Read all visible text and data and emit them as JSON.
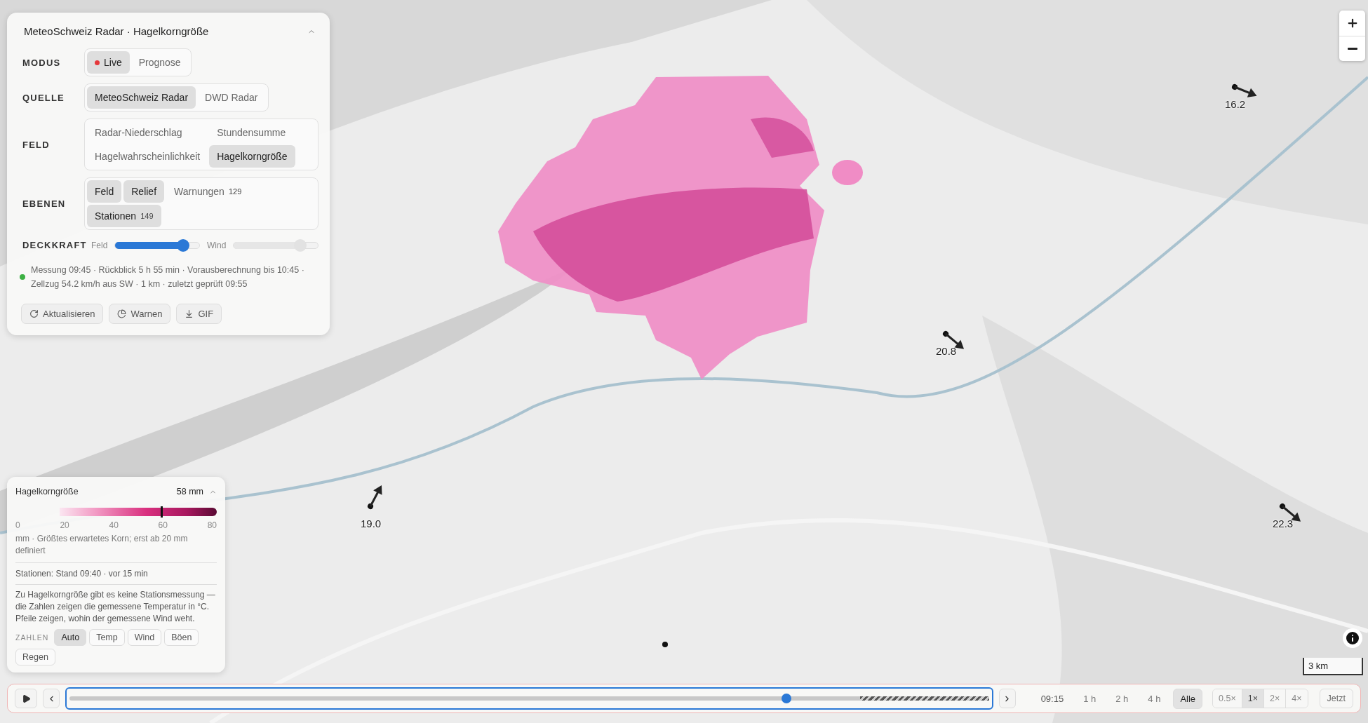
{
  "panel": {
    "title": "MeteoSchweiz Radar · Hagelkorngröße",
    "collapsed": false,
    "rows": [
      {
        "label": "MODUS",
        "options": [
          {
            "label": "Live",
            "selected": true,
            "indicator": true
          },
          {
            "label": "Prognose",
            "selected": false,
            "indicator": false
          }
        ]
      },
      {
        "label": "QUELLE",
        "options": [
          {
            "label": "MeteoSchweiz Radar",
            "selected": true,
            "indicator": false
          },
          {
            "label": "DWD Radar",
            "selected": false,
            "indicator": false
          }
        ]
      },
      {
        "label": "FELD",
        "options": [
          {
            "label": "Radar-Niederschlag",
            "selected": false,
            "indicator": false
          },
          {
            "label": "Stundensumme",
            "selected": false,
            "indicator": false
          },
          {
            "label": "Hagelwahrscheinlichkeit",
            "selected": false,
            "indicator": false
          },
          {
            "label": "Hagelkorngröße",
            "selected": true,
            "indicator": false
          }
        ]
      },
      {
        "label": "EBENEN",
        "options": [
          {
            "label": "Feld",
            "selected": true,
            "indicator": false
          },
          {
            "label": "Relief",
            "selected": true,
            "indicator": false
          },
          {
            "label": "Warnungen",
            "count": "129",
            "selected": false,
            "indicator": false
          },
          {
            "label": "Stationen",
            "count": "149",
            "selected": true,
            "indicator": false
          }
        ]
      }
    ],
    "opacity": {
      "label": "DECKKRAFT",
      "sliders": [
        {
          "label": "Feld",
          "level": 0.81,
          "disabled": false
        },
        {
          "label": "Wind",
          "level": 0.79,
          "disabled": true
        }
      ]
    },
    "status": {
      "ok": true,
      "text": "Messung 09:45 · Rückblick 5 h 55 min · Vorausberechnung bis 10:45 · Zellzug 54.2 km/h aus SW · 1 km · zuletzt geprüft 09:55"
    },
    "actions": [
      {
        "label": "Aktualisieren"
      },
      {
        "label": "Warnen"
      },
      {
        "label": "GIF"
      }
    ]
  },
  "legend": {
    "title": "Hagelkorngröße",
    "value": "58 mm",
    "collapsed": false,
    "scale": {
      "level": 0.725,
      "ticks": [
        "0",
        "20",
        "40",
        "60",
        "80"
      ]
    },
    "unit_note": "mm · Größtes erwartetes Korn; erst ab 20 mm definiert",
    "stations_note": "Stationen: Stand 09:40 · vor 15 min",
    "info": "Zu Hagelkorngröße gibt es keine Stationsmessung — die Zahlen zeigen die gemessene Temperatur in °C. Pfeile zeigen, wohin der gemessene Wind weht.",
    "numbers": {
      "label": "ZAHLEN",
      "options": [
        {
          "label": "Auto",
          "selected": true
        },
        {
          "label": "Temp",
          "selected": false
        },
        {
          "label": "Wind",
          "selected": false
        },
        {
          "label": "Böen",
          "selected": false
        },
        {
          "label": "Regen",
          "selected": false
        }
      ]
    }
  },
  "map": {
    "kind": "picture",
    "stations": [
      {
        "kind": "arrow",
        "value": "16.2"
      },
      {
        "kind": "arrow",
        "value": "20.8"
      },
      {
        "kind": "arrow",
        "value": "19.0"
      },
      {
        "kind": "arrow",
        "value": "22.3"
      },
      {
        "kind": "dot"
      }
    ],
    "scale_bar": "3 km"
  },
  "timeline": {
    "playing": false,
    "level": 0.78,
    "forecast": {
      "level": 0.14
    },
    "time": "09:15",
    "ranges": [
      {
        "label": "1 h",
        "selected": false
      },
      {
        "label": "2 h",
        "selected": false
      },
      {
        "label": "4 h",
        "selected": false
      },
      {
        "label": "Alle",
        "selected": true
      }
    ],
    "speeds": [
      {
        "label": "0.5×",
        "selected": false
      },
      {
        "label": "1×",
        "selected": true
      },
      {
        "label": "2×",
        "selected": false
      },
      {
        "label": "4×",
        "selected": false
      }
    ],
    "now": "Jetzt"
  }
}
